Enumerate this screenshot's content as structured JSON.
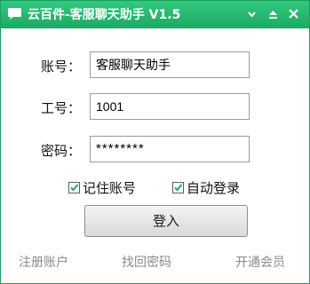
{
  "window": {
    "title": "云百件-客服聊天助手 V1.5",
    "accent_color": "#1ea864",
    "icons": {
      "app": "chat-bubble-icon",
      "settings": "settings-icon",
      "minimize": "minimize-icon",
      "close": "close-icon"
    }
  },
  "form": {
    "account_label": "账号：",
    "account_value": "客服聊天助手",
    "id_label": "工号：",
    "id_value": "1001",
    "password_label": "密码：",
    "password_value": "********"
  },
  "options": {
    "remember_account": {
      "label": "记住账号",
      "checked": true
    },
    "auto_login": {
      "label": "自动登录",
      "checked": true
    }
  },
  "login_button": "登入",
  "footer": {
    "register": "注册账户",
    "recover_password": "找回密码",
    "membership": "开通会员"
  }
}
